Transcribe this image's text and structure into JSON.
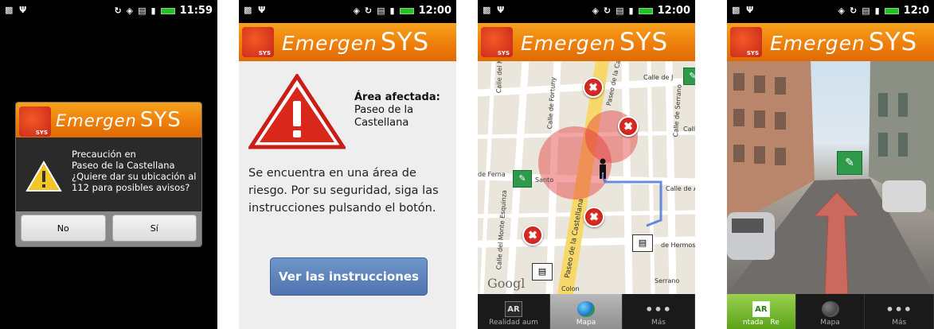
{
  "status": {
    "screen1_time": "11:59",
    "screen2_time": "12:00",
    "screen3_time": "12:00",
    "screen4_time": "12:0"
  },
  "brand": {
    "emergen": "Emergen",
    "sys": "SYS",
    "badge": "SYS",
    "accent": "#ee7f0c"
  },
  "dialog": {
    "message_lines": [
      "Precaución en",
      "Paseo de la Castellana",
      "¿Quiere dar su ubicación al",
      "112 para posibles avisos?"
    ],
    "no_label": "No",
    "yes_label": "Sí"
  },
  "alert_screen": {
    "area_title": "Área afectada:",
    "area_name": "Paseo de la Castellana",
    "message": "Se encuentra en una área de riesgo. Por su seguridad, siga las instrucciones pulsando el botón.",
    "button_label": "Ver las instrucciones",
    "button_color": "#5b80bd"
  },
  "map": {
    "streets": [
      "Calle del Monte Esq",
      "Calle de Fortuny",
      "Paseo de la Ca",
      "Calle de J",
      "Calle de Serrano",
      "Call",
      "de Ferna",
      "Santo",
      "Calle de Aya",
      "Paseo de la Castellana",
      "Calle del Monte Esquinza",
      "de Hermosilla",
      "Serrano",
      "Colon"
    ],
    "google_text": "Googl",
    "danger_color": "#e0322a"
  },
  "tabs": {
    "map_screen": [
      {
        "icon": "ar-icon",
        "label": "Realidad aum"
      },
      {
        "icon": "globe-icon",
        "label": "Mapa"
      },
      {
        "icon": "more-icon",
        "label": "Más"
      }
    ],
    "street_screen": [
      {
        "icon": "ar-icon",
        "label": "ntada",
        "label2": "Re"
      },
      {
        "icon": "globe-icon",
        "label": "Mapa"
      },
      {
        "icon": "more-icon",
        "label": "Más"
      }
    ]
  }
}
